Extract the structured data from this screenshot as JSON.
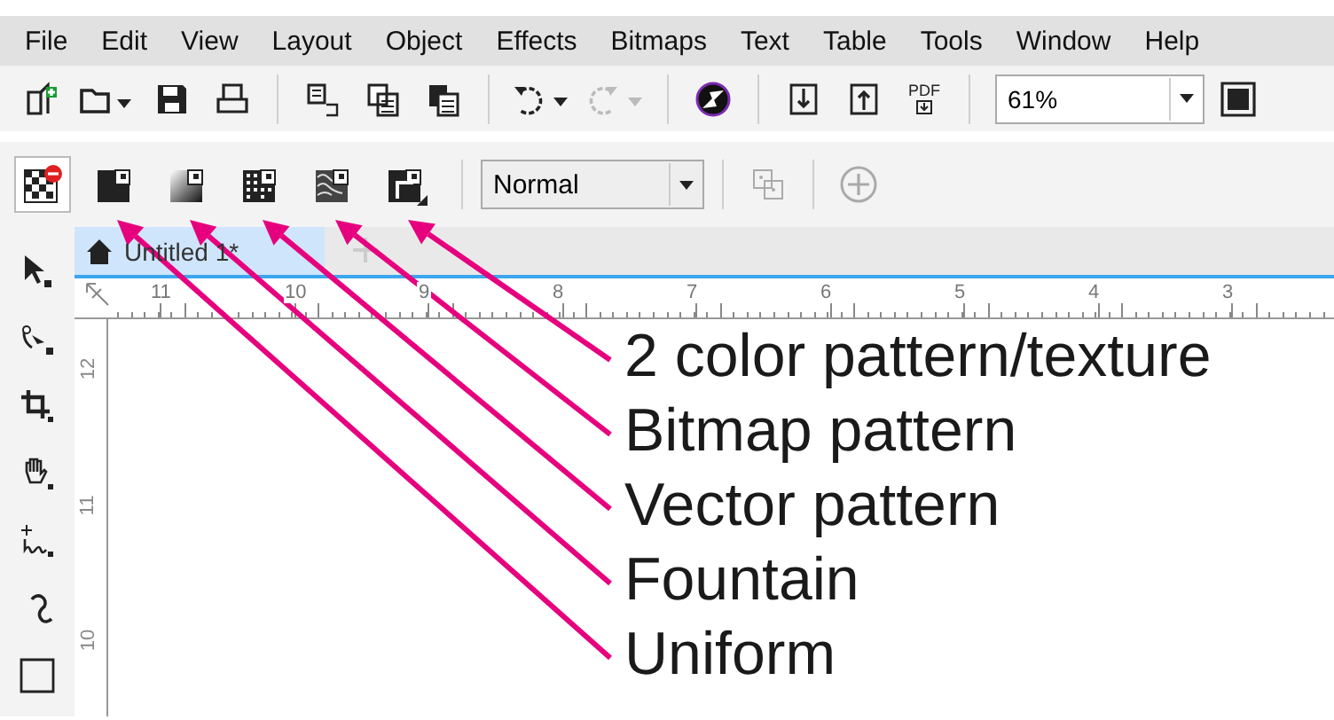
{
  "menu": [
    {
      "label": "File"
    },
    {
      "label": "Edit"
    },
    {
      "label": "View"
    },
    {
      "label": "Layout"
    },
    {
      "label": "Object"
    },
    {
      "label": "Effects"
    },
    {
      "label": "Bitmaps"
    },
    {
      "label": "Text"
    },
    {
      "label": "Table"
    },
    {
      "label": "Tools"
    },
    {
      "label": "Window"
    },
    {
      "label": "Help"
    }
  ],
  "standard_toolbar": {
    "zoom_level": "61%",
    "pdf_label": "PDF"
  },
  "fill_buttons": [
    {
      "kind": "none",
      "selected": true
    },
    {
      "kind": "uniform",
      "selected": false
    },
    {
      "kind": "fountain",
      "selected": false
    },
    {
      "kind": "vector",
      "selected": false
    },
    {
      "kind": "bitmap",
      "selected": false
    },
    {
      "kind": "two-color",
      "selected": false
    }
  ],
  "blend_mode": "Normal",
  "document_tab": {
    "title": "Untitled 1*",
    "selected": true
  },
  "horizontal_ruler": [
    "11",
    "10",
    "9",
    "8",
    "7",
    "6",
    "5",
    "4",
    "3"
  ],
  "vertical_ruler": [
    "12",
    "11",
    "10"
  ],
  "callouts": [
    "2 color pattern/texture",
    "Bitmap pattern",
    "Vector pattern",
    "Fountain",
    "Uniform"
  ]
}
